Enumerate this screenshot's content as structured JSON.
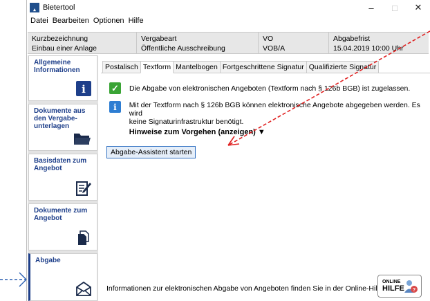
{
  "window": {
    "title": "Bietertool"
  },
  "menu": [
    "Datei",
    "Bearbeiten",
    "Optionen",
    "Hilfe"
  ],
  "window_controls": {
    "minimize": "–",
    "maximize": "□",
    "close": "✕"
  },
  "info": {
    "kurz_label": "Kurzbezeichnung",
    "kurz_value": "Einbau einer Anlage",
    "vergabeart_label": "Vergabeart",
    "vergabeart_value": "Öffentliche Ausschreibung",
    "vo_label": "VO",
    "vo_value": "VOB/A",
    "frist_label": "Abgabefrist",
    "frist_value": "15.04.2019 10:00 Uhr"
  },
  "sidebar": {
    "items": [
      {
        "label": "Allgemeine Informationen",
        "icon": "info-icon"
      },
      {
        "label": "Dokumente aus den Vergabe-unterlagen",
        "icon": "folder-icon"
      },
      {
        "label": "Basisdaten zum Angebot",
        "icon": "edit-document-icon"
      },
      {
        "label": "Dokumente zum Angebot",
        "icon": "documents-icon"
      },
      {
        "label": "Abgabe",
        "icon": "envelope-icon"
      }
    ]
  },
  "tabs": [
    "Postalisch",
    "Textform",
    "Mantelbogen",
    "Fortgeschrittene Signatur",
    "Qualifizierte Signatur"
  ],
  "content": {
    "allowed_text": "Die Abgabe von elektronischen Angeboten (Textform nach § 126b BGB) ist zugelassen.",
    "info_line1": "Mit der Textform nach § 126b BGB können elektronische Angebote abgegeben werden. Es wird",
    "info_line2": "keine Signaturinfrastruktur benötigt.",
    "hint_link": "Hinweise zum Vorgehen (anzeigen) ▼",
    "start_button": "Abgabe-Assistent starten",
    "footer": "Informationen zur elektronischen Abgabe von Angeboten finden Sie in der Online-Hilfe",
    "online_help_top": "ONLINE",
    "online_help_bottom": "HILFE"
  },
  "colors": {
    "accent": "#1e3f8a",
    "annotation": "#e02020",
    "annotation_blue": "#2a5fb0"
  }
}
